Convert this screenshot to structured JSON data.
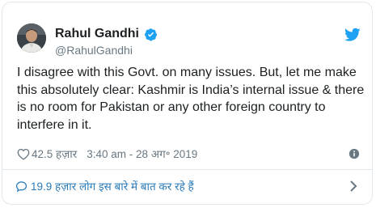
{
  "tweet": {
    "author_name": "Rahul Gandhi",
    "handle": "@RahulGandhi",
    "text": "I disagree with this Govt. on many issues. But, let me make this absolutely clear: Kashmir is India’s internal issue & there is no room for Pakistan or any other foreign country to interfere in it.",
    "likes": "42.5 हज़ार",
    "timestamp": "3:40 am - 28 अग॰ 2019"
  },
  "footer": {
    "replies_text": "19.9 हज़ार लोग इस बारे में बात कर रहे हैं"
  },
  "colors": {
    "twitter_blue": "#1da1f2",
    "link_blue": "#2b7bb9",
    "muted_gray": "#697882",
    "border": "#e1e8ed"
  },
  "icons": {
    "verified": "verified-badge-icon",
    "logo": "twitter-bird-icon",
    "like": "heart-icon",
    "info": "info-icon",
    "reply": "speech-bubble-icon",
    "more": "chevron-right-icon"
  }
}
